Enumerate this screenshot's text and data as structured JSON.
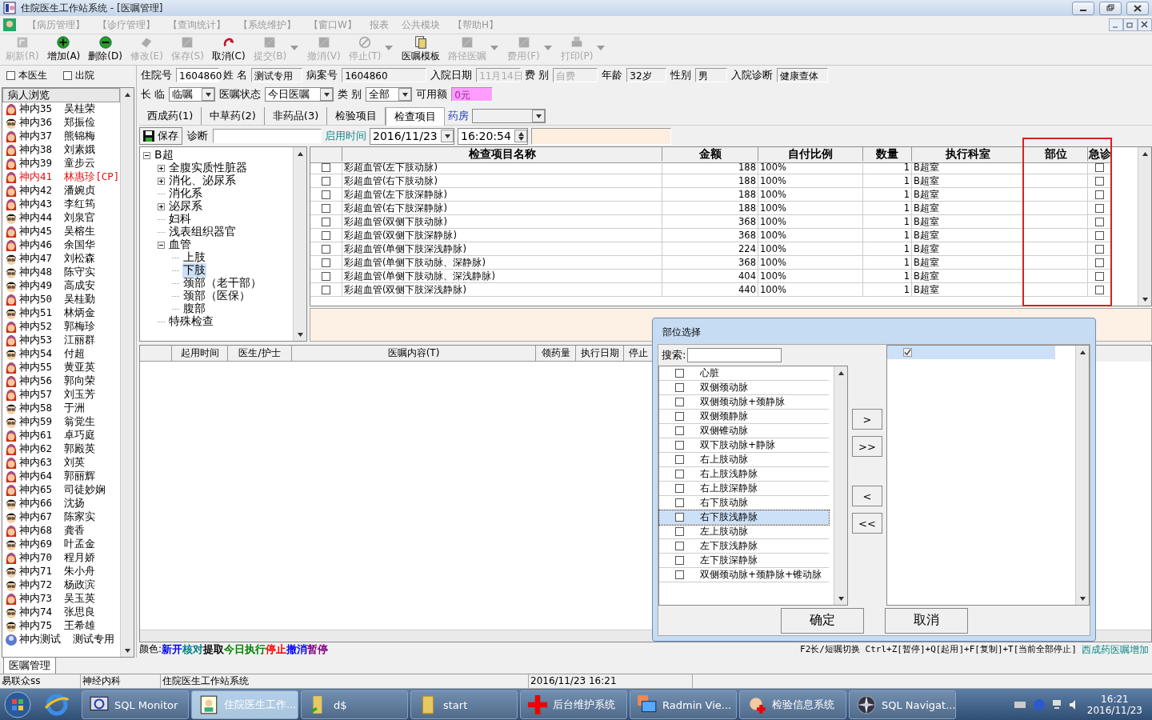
{
  "window": {
    "title": "住院医生工作站系统 - [医嘱管理]"
  },
  "menu": [
    "【病历管理】",
    "【诊疗管理】",
    "【查询统计】",
    "【系统维护】",
    "【窗口W】",
    "报表",
    "公共模块",
    "【帮助H】"
  ],
  "toolbar": [
    {
      "label": "刷新(R)",
      "kind": "refresh",
      "disabled": true,
      "menu": false
    },
    {
      "label": "增加(A)",
      "kind": "add",
      "disabled": false,
      "menu": false
    },
    {
      "label": "删除(D)",
      "kind": "remove",
      "disabled": false,
      "menu": false
    },
    {
      "label": "修改(E)",
      "kind": "edit",
      "disabled": true,
      "menu": false
    },
    {
      "label": "保存(S)",
      "kind": "save",
      "disabled": true,
      "menu": false
    },
    {
      "label": "取消(C)",
      "kind": "undo",
      "disabled": false,
      "menu": false
    },
    {
      "label": "提交(B)",
      "kind": "block",
      "disabled": true,
      "menu": true
    },
    {
      "label": "撤消(V)",
      "kind": "block",
      "disabled": true,
      "menu": false
    },
    {
      "label": "停止(T)",
      "kind": "stop",
      "disabled": true,
      "menu": true
    },
    {
      "label": "医嘱模板",
      "kind": "template",
      "disabled": false,
      "menu": false
    },
    {
      "label": "路径医嘱",
      "kind": "block",
      "disabled": true,
      "menu": true
    },
    {
      "label": "费用(F)",
      "kind": "block",
      "disabled": true,
      "menu": true
    },
    {
      "label": "打印(P)",
      "kind": "print",
      "disabled": true,
      "menu": true
    }
  ],
  "filters": [
    {
      "label": "本医生",
      "checked": false
    },
    {
      "label": "出院",
      "checked": false
    }
  ],
  "patients": {
    "header": "病人浏览",
    "items": [
      {
        "bed": "神内35",
        "name": "吴桂荣",
        "kind": "female",
        "alert": false
      },
      {
        "bed": "神内36",
        "name": "郑振俭",
        "kind": "male",
        "alert": false
      },
      {
        "bed": "神内37",
        "name": "熊锦梅",
        "kind": "female",
        "alert": false
      },
      {
        "bed": "神内38",
        "name": "刘素娥",
        "kind": "female",
        "alert": false
      },
      {
        "bed": "神内39",
        "name": "童步云",
        "kind": "female",
        "alert": false
      },
      {
        "bed": "神内41",
        "name": "林惠珍[CP]",
        "kind": "female",
        "alert": true
      },
      {
        "bed": "神内42",
        "name": "潘婉贞",
        "kind": "female",
        "alert": false
      },
      {
        "bed": "神内43",
        "name": "李红筠",
        "kind": "female",
        "alert": false
      },
      {
        "bed": "神内44",
        "name": "刘泉官",
        "kind": "male",
        "alert": false
      },
      {
        "bed": "神内45",
        "name": "吴榕生",
        "kind": "female",
        "alert": false
      },
      {
        "bed": "神内46",
        "name": "余国华",
        "kind": "female",
        "alert": false
      },
      {
        "bed": "神内47",
        "name": "刘松森",
        "kind": "male",
        "alert": false
      },
      {
        "bed": "神内48",
        "name": "陈守实",
        "kind": "male",
        "alert": false
      },
      {
        "bed": "神内49",
        "name": "高成安",
        "kind": "male",
        "alert": false
      },
      {
        "bed": "神内50",
        "name": "吴桂勤",
        "kind": "female",
        "alert": false
      },
      {
        "bed": "神内51",
        "name": "林炳金",
        "kind": "male",
        "alert": false
      },
      {
        "bed": "神内52",
        "name": "郭梅珍",
        "kind": "female",
        "alert": false
      },
      {
        "bed": "神内53",
        "name": "江丽群",
        "kind": "female",
        "alert": false
      },
      {
        "bed": "神内54",
        "name": "付超",
        "kind": "male",
        "alert": false
      },
      {
        "bed": "神内55",
        "name": "黄亚英",
        "kind": "female",
        "alert": false
      },
      {
        "bed": "神内56",
        "name": "郭向荣",
        "kind": "female",
        "alert": false
      },
      {
        "bed": "神内57",
        "name": "刘玉芳",
        "kind": "female",
        "alert": false
      },
      {
        "bed": "神内58",
        "name": "于洲",
        "kind": "male",
        "alert": false
      },
      {
        "bed": "神内59",
        "name": "翁觉生",
        "kind": "male",
        "alert": false
      },
      {
        "bed": "神内61",
        "name": "卓巧庭",
        "kind": "female",
        "alert": false
      },
      {
        "bed": "神内62",
        "name": "郭殿英",
        "kind": "female",
        "alert": false
      },
      {
        "bed": "神内63",
        "name": "刘英",
        "kind": "female",
        "alert": false
      },
      {
        "bed": "神内64",
        "name": "郭丽辉",
        "kind": "female",
        "alert": false
      },
      {
        "bed": "神内65",
        "name": "司徒妙娴",
        "kind": "female",
        "alert": false
      },
      {
        "bed": "神内66",
        "name": "沈扬",
        "kind": "male",
        "alert": false
      },
      {
        "bed": "神内67",
        "name": "陈家实",
        "kind": "male",
        "alert": false
      },
      {
        "bed": "神内68",
        "name": "龚香",
        "kind": "female",
        "alert": false
      },
      {
        "bed": "神内69",
        "name": "叶孟金",
        "kind": "male",
        "alert": false
      },
      {
        "bed": "神内70",
        "name": "程月娇",
        "kind": "female",
        "alert": false
      },
      {
        "bed": "神内71",
        "name": "朱小舟",
        "kind": "male",
        "alert": false
      },
      {
        "bed": "神内72",
        "name": "杨政滨",
        "kind": "male",
        "alert": false
      },
      {
        "bed": "神内73",
        "name": "吴玉英",
        "kind": "female",
        "alert": false
      },
      {
        "bed": "神内74",
        "name": "张思良",
        "kind": "male",
        "alert": false
      },
      {
        "bed": "神内75",
        "name": "王希雄",
        "kind": "male",
        "alert": false
      },
      {
        "bed": "神内测试",
        "name": "测试专用",
        "kind": "test",
        "alert": false
      }
    ]
  },
  "form": {
    "row1": [
      {
        "label": "住院号",
        "value": "1604860",
        "kind": "input"
      },
      {
        "label": "姓 名",
        "value": "测试专用",
        "kind": "readonly"
      },
      {
        "label": "病案号",
        "value": "1604860",
        "kind": "readonly"
      },
      {
        "label": "入院日期",
        "value": "11月14日",
        "kind": "disabled"
      },
      {
        "label": "费 别",
        "value": "自费",
        "kind": "disabled"
      },
      {
        "label": "年龄",
        "value": "32岁",
        "kind": "readonly"
      },
      {
        "label": "性别",
        "value": "男",
        "kind": "readonly"
      },
      {
        "label": "入院诊断",
        "value": "健康查体",
        "kind": "readonly"
      }
    ],
    "row2": [
      {
        "label": "长 临",
        "value": "临嘱",
        "kind": "combo"
      },
      {
        "label": "医嘱状态",
        "value": "今日医嘱",
        "kind": "combo"
      },
      {
        "label": "类 别",
        "value": "全部",
        "kind": "combo"
      },
      {
        "label": "可用额",
        "value": "0元",
        "kind": "pink"
      }
    ]
  },
  "tabs": [
    {
      "label": "西成药(1)",
      "selected": false
    },
    {
      "label": "中草药(2)",
      "selected": false
    },
    {
      "label": "非药品(3)",
      "selected": false
    },
    {
      "label": "检验项目",
      "selected": false
    },
    {
      "label": "检查项目",
      "selected": true
    }
  ],
  "pharmacy": {
    "label": "药房"
  },
  "entry": {
    "save": "保存",
    "diagnosis_label": "诊断",
    "start_label": "启用时间",
    "date": "2016/11/23",
    "time": "16:20:54"
  },
  "tree": [
    {
      "label": "B超",
      "expanded": true,
      "selected": false,
      "children": [
        {
          "label": "全腹实质性脏器",
          "expanded": false,
          "selected": false
        },
        {
          "label": "消化、泌尿系",
          "expanded": false,
          "selected": false
        },
        {
          "label": "消化系",
          "selected": false
        },
        {
          "label": "泌尿系",
          "expanded": false,
          "selected": false
        },
        {
          "label": "妇科",
          "selected": false
        },
        {
          "label": "浅表组织器官",
          "selected": false
        },
        {
          "label": "血管",
          "expanded": true,
          "selected": false,
          "children": [
            {
              "label": "上肢",
              "selected": false
            },
            {
              "label": "下肢",
              "selected": true
            },
            {
              "label": "颈部（老干部）",
              "selected": false
            },
            {
              "label": "颈部（医保）",
              "selected": false
            },
            {
              "label": "腹部",
              "selected": false
            }
          ]
        },
        {
          "label": "特殊检查",
          "selected": false
        }
      ]
    }
  ],
  "exam_table": {
    "columns": [
      "检查项目名称",
      "金额",
      "自付比例",
      "数量",
      "执行科室",
      "部位",
      "急诊"
    ],
    "rows": [
      {
        "checked": false,
        "name": "彩超血管(左下肢动脉)",
        "amount": "188",
        "ratio": "100%",
        "qty": "1",
        "dept": "B超室",
        "urgent": false
      },
      {
        "checked": false,
        "name": "彩超血管(右下肢动脉)",
        "amount": "188",
        "ratio": "100%",
        "qty": "1",
        "dept": "B超室",
        "urgent": false
      },
      {
        "checked": false,
        "name": "彩超血管(左下肢深静脉)",
        "amount": "188",
        "ratio": "100%",
        "qty": "1",
        "dept": "B超室",
        "urgent": false
      },
      {
        "checked": false,
        "name": "彩超血管(右下肢深静脉)",
        "amount": "188",
        "ratio": "100%",
        "qty": "1",
        "dept": "B超室",
        "urgent": false
      },
      {
        "checked": false,
        "name": "彩超血管(双侧下肢动脉)",
        "amount": "368",
        "ratio": "100%",
        "qty": "1",
        "dept": "B超室",
        "urgent": false
      },
      {
        "checked": false,
        "name": "彩超血管(双侧下肢深静脉)",
        "amount": "368",
        "ratio": "100%",
        "qty": "1",
        "dept": "B超室",
        "urgent": false
      },
      {
        "checked": false,
        "name": "彩超血管(单侧下肢深浅静脉)",
        "amount": "224",
        "ratio": "100%",
        "qty": "1",
        "dept": "B超室",
        "urgent": false
      },
      {
        "checked": false,
        "name": "彩超血管(单侧下肢动脉、深静脉)",
        "amount": "368",
        "ratio": "100%",
        "qty": "1",
        "dept": "B超室",
        "urgent": false
      },
      {
        "checked": false,
        "name": "彩超血管(单侧下肢动脉、深浅静脉)",
        "amount": "404",
        "ratio": "100%",
        "qty": "1",
        "dept": "B超室",
        "urgent": false
      },
      {
        "checked": false,
        "name": "彩超血管(双侧下肢深浅静脉)",
        "amount": "440",
        "ratio": "100%",
        "qty": "1",
        "dept": "B超室",
        "urgent": false
      }
    ]
  },
  "orders_table": {
    "columns": [
      "起用时间",
      "医生/护士",
      "医嘱内容(T)",
      "领药量",
      "执行日期",
      "停止"
    ]
  },
  "legend": {
    "label": "颜色:",
    "items": [
      {
        "text": "新开",
        "color": "#0000ff"
      },
      {
        "text": "核对",
        "color": "#008080"
      },
      {
        "text": "提取",
        "color": "#000000"
      },
      {
        "text": "今日执行",
        "color": "#008000"
      },
      {
        "text": "停止",
        "color": "#ff0000"
      },
      {
        "text": "撤消",
        "color": "#0000ff"
      },
      {
        "text": "暂停",
        "color": "#800080"
      }
    ],
    "shortcuts": "F2长/短嘱切换 Ctrl+Z[暂停]+Q[起用]+F[复制]+T[当前全部停止]",
    "link": "西成药医嘱增加"
  },
  "bottom_tabs": [
    {
      "label": "医嘱管理",
      "selected": true
    }
  ],
  "status_bar": [
    "易联众ss",
    "神经内科",
    "住院医生工作站系统",
    "2016/11/23 16:21"
  ],
  "dialog": {
    "title": "部位选择",
    "search_label": "搜索:",
    "items": [
      {
        "label": "心脏",
        "checked": false,
        "selected": false
      },
      {
        "label": "双侧颈动脉",
        "checked": false,
        "selected": false
      },
      {
        "label": "双侧颈动脉+颈静脉",
        "checked": false,
        "selected": false
      },
      {
        "label": "双侧颈静脉",
        "checked": false,
        "selected": false
      },
      {
        "label": "双侧锥动脉",
        "checked": false,
        "selected": false
      },
      {
        "label": "双下肢动脉+静脉",
        "checked": false,
        "selected": false
      },
      {
        "label": "右上肢动脉",
        "checked": false,
        "selected": false
      },
      {
        "label": "右上肢浅静脉",
        "checked": false,
        "selected": false
      },
      {
        "label": "右上肢深静脉",
        "checked": false,
        "selected": false
      },
      {
        "label": "右下肢动脉",
        "checked": false,
        "selected": false
      },
      {
        "label": "右下肢浅静脉",
        "checked": false,
        "selected": true
      },
      {
        "label": "左上肢动脉",
        "checked": false,
        "selected": false
      },
      {
        "label": "左下肢浅静脉",
        "checked": false,
        "selected": false
      },
      {
        "label": "左下肢深静脉",
        "checked": false,
        "selected": false
      },
      {
        "label": "双侧颈动脉+颈静脉+锥动脉",
        "checked": false,
        "selected": false
      }
    ],
    "move_buttons": [
      ">",
      ">>",
      "<",
      "<<"
    ],
    "chosen": [
      {
        "checked": true,
        "selected": true
      }
    ],
    "ok": "确定",
    "cancel": "取消"
  },
  "taskbar": {
    "apps": [
      {
        "label": "SQL Monitor",
        "kind": "monitor",
        "selected": false
      },
      {
        "label": "住院医生工作...",
        "kind": "doctor",
        "selected": true
      },
      {
        "label": "d$",
        "kind": "drive",
        "selected": false
      },
      {
        "label": "start",
        "kind": "folder",
        "selected": false
      },
      {
        "label": "后台维护系统",
        "kind": "cross",
        "selected": false
      },
      {
        "label": "Radmin Vie...",
        "kind": "radmin",
        "selected": false
      },
      {
        "label": "检验信息系统",
        "kind": "lab",
        "selected": false
      },
      {
        "label": "SQL Navigat...",
        "kind": "compass",
        "selected": false
      }
    ],
    "time": "16:21",
    "date": "2016/11/23"
  }
}
